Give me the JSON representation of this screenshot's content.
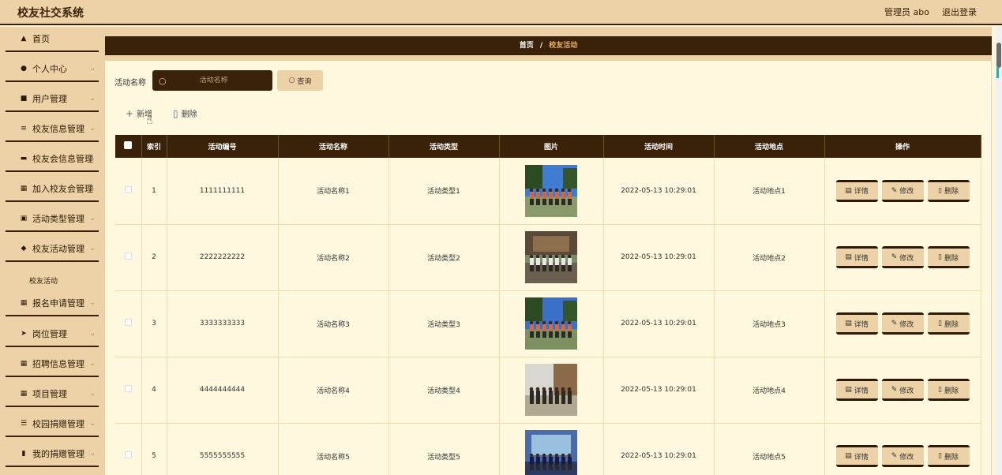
{
  "header": {
    "title": "校友社交系统",
    "user": "管理员 abo",
    "logout": "退出登录"
  },
  "sidebar": {
    "items": [
      {
        "label": "首页",
        "icon": "home-icon",
        "glyph": "▲"
      },
      {
        "label": "个人中心",
        "icon": "person-icon",
        "glyph": "●"
      },
      {
        "label": "用户管理",
        "icon": "edit-icon",
        "glyph": "■"
      },
      {
        "label": "校友信息管理",
        "icon": "sliders-icon",
        "glyph": "≡"
      },
      {
        "label": "校友会信息管理",
        "icon": "briefcase-icon",
        "glyph": "▬"
      },
      {
        "label": "加入校友会管理",
        "icon": "grid-icon",
        "glyph": "▦"
      },
      {
        "label": "活动类型管理",
        "icon": "clipboard-icon",
        "glyph": "▣"
      },
      {
        "label": "校友活动管理",
        "icon": "thumb-icon",
        "glyph": "◆"
      },
      {
        "label": "报名申请管理",
        "icon": "grid-icon",
        "glyph": "▦"
      },
      {
        "label": "岗位管理",
        "icon": "send-icon",
        "glyph": "➤"
      },
      {
        "label": "招聘信息管理",
        "icon": "grid-icon",
        "glyph": "▦"
      },
      {
        "label": "项目管理",
        "icon": "grid-icon",
        "glyph": "▦"
      },
      {
        "label": "校园捐赠管理",
        "icon": "list-icon",
        "glyph": "☰"
      },
      {
        "label": "我的捐赠管理",
        "icon": "bar-chart-icon",
        "glyph": "▮"
      }
    ],
    "sub_item": "校友活动"
  },
  "breadcrumb": {
    "home": "首页",
    "sep": "/",
    "current": "校友活动"
  },
  "search": {
    "label": "活动名称",
    "placeholder": "活动名称",
    "button": "查询"
  },
  "toolbar": {
    "add": "新增",
    "delete": "删除"
  },
  "table": {
    "headers": [
      "",
      "索引",
      "活动编号",
      "活动名称",
      "活动类型",
      "图片",
      "活动时间",
      "活动地点",
      "操作"
    ],
    "rows": [
      {
        "index": "1",
        "code": "1111111111",
        "name": "活动名称1",
        "type": "活动类型1",
        "time": "2022-05-13 10:29:01",
        "place": "活动地点1"
      },
      {
        "index": "2",
        "code": "2222222222",
        "name": "活动名称2",
        "type": "活动类型2",
        "time": "2022-05-13 10:29:01",
        "place": "活动地点2"
      },
      {
        "index": "3",
        "code": "3333333333",
        "name": "活动名称3",
        "type": "活动类型3",
        "time": "2022-05-13 10:29:01",
        "place": "活动地点3"
      },
      {
        "index": "4",
        "code": "4444444444",
        "name": "活动名称4",
        "type": "活动类型4",
        "time": "2022-05-13 10:29:01",
        "place": "活动地点4"
      },
      {
        "index": "5",
        "code": "5555555555",
        "name": "活动名称5",
        "type": "活动类型5",
        "time": "2022-05-13 10:29:01",
        "place": "活动地点5"
      }
    ],
    "ops": {
      "detail": "详情",
      "edit": "修改",
      "delete": "删除"
    }
  }
}
